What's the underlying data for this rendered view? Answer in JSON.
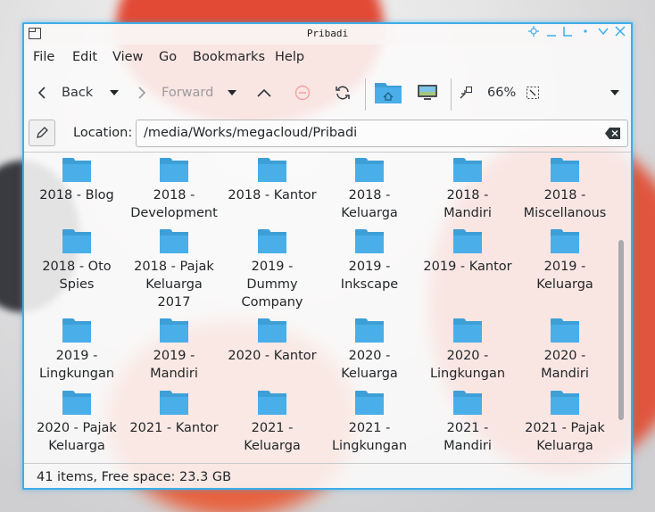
{
  "window": {
    "title": "Pribadi"
  },
  "menubar": {
    "items": [
      "File",
      "Edit",
      "View",
      "Go",
      "Bookmarks",
      "Help"
    ]
  },
  "toolbar": {
    "back_label": "Back",
    "forward_label": "Forward",
    "zoom_label": "66%"
  },
  "location": {
    "label": "Location:",
    "path": "/media/Works/megacloud/Pribadi"
  },
  "folders": [
    "2018 - Blog",
    "2018 - Development",
    "2018 - Kantor",
    "2018 - Keluarga",
    "2018 - Mandiri",
    "2018 - Miscellanous",
    "2018 - Oto Spies",
    "2018 - Pajak Keluarga 2017",
    "2019 - Dummy Company",
    "2019 - Inkscape",
    "2019 - Kantor",
    "2019 - Keluarga",
    "2019 - Lingkungan",
    "2019 - Mandiri",
    "2020 - Kantor",
    "2020 - Keluarga",
    "2020 - Lingkungan",
    "2020 - Mandiri",
    "2020 - Pajak Keluarga",
    "2021 - Kantor",
    "2021 - Keluarga",
    "2021 - Lingkungan",
    "2021 - Mandiri",
    "2021 - Pajak Keluarga"
  ],
  "folder_lines": [
    [
      "2018 - Blog"
    ],
    [
      "2018 -",
      "Development"
    ],
    [
      "2018 - Kantor"
    ],
    [
      "2018 -",
      "Keluarga"
    ],
    [
      "2018 -",
      "Mandiri"
    ],
    [
      "2018 -",
      "Miscellanous"
    ],
    [
      "2018 - Oto",
      "Spies"
    ],
    [
      "2018 - Pajak",
      "Keluarga",
      "2017"
    ],
    [
      "2019 -",
      "Dummy",
      "Company"
    ],
    [
      "2019 -",
      "Inkscape"
    ],
    [
      "2019 - Kantor"
    ],
    [
      "2019 -",
      "Keluarga"
    ],
    [
      "2019 -",
      "Lingkungan"
    ],
    [
      "2019 -",
      "Mandiri"
    ],
    [
      "2020 - Kantor"
    ],
    [
      "2020 -",
      "Keluarga"
    ],
    [
      "2020 -",
      "Lingkungan"
    ],
    [
      "2020 -",
      "Mandiri"
    ],
    [
      "2020 - Pajak",
      "Keluarga"
    ],
    [
      "2021 - Kantor"
    ],
    [
      "2021 -",
      "Keluarga"
    ],
    [
      "2021 -",
      "Lingkungan"
    ],
    [
      "2021 -",
      "Mandiri"
    ],
    [
      "2021 - Pajak",
      "Keluarga"
    ]
  ],
  "status": {
    "text": "41 items, Free space: 23.3 GB"
  },
  "colors": {
    "accent": "#3daee9",
    "folder": "#4aaee8"
  },
  "icons": [
    "back-icon",
    "forward-icon",
    "up-icon",
    "stop-icon",
    "reload-icon",
    "home-icon",
    "computer-icon",
    "zoom-out-icon",
    "zoom-in-icon",
    "edit-icon",
    "clear-icon"
  ]
}
